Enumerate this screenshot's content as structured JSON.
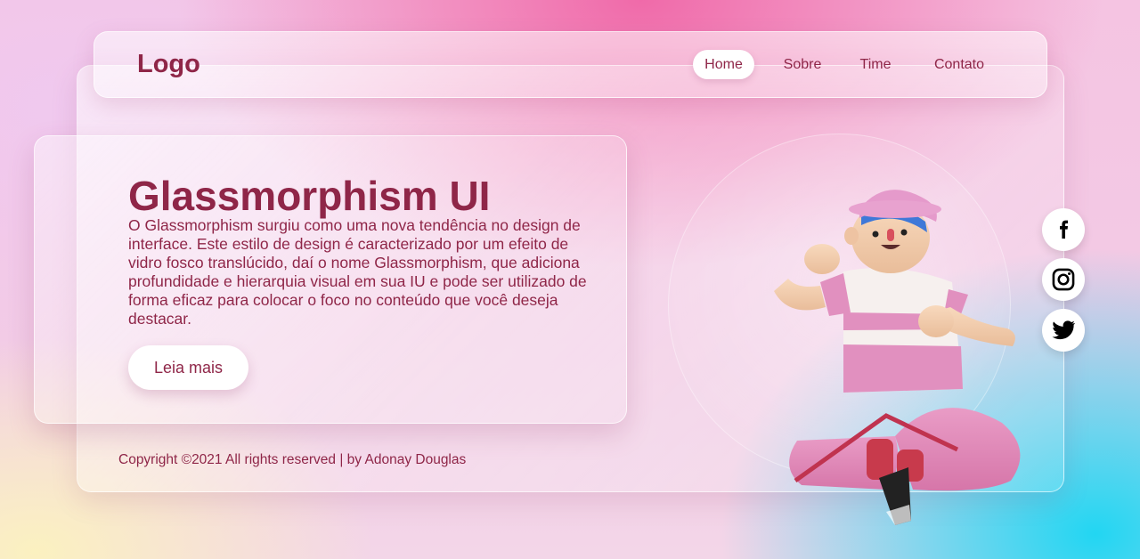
{
  "header": {
    "logo": "Logo",
    "nav": [
      {
        "label": "Home",
        "active": true
      },
      {
        "label": "Sobre",
        "active": false
      },
      {
        "label": "Time",
        "active": false
      },
      {
        "label": "Contato",
        "active": false
      }
    ]
  },
  "hero": {
    "title": "Glassmorphism UI",
    "description": "O Glassmorphism surgiu como uma nova tendência no design de interface. Este estilo de design é caracterizado por um efeito de vidro fosco translúcido, daí o nome Glassmorphism, que adiciona profundidade e hierarquia visual em sua IU e pode ser utilizado de forma eficaz para colocar o foco no conteúdo que você deseja destacar.",
    "button_label": "Leia mais"
  },
  "footer": {
    "copyright": "Copyright ©2021 All rights reserved | by Adonay Douglas"
  },
  "social": [
    {
      "icon": "facebook-icon"
    },
    {
      "icon": "instagram-icon"
    },
    {
      "icon": "twitter-icon"
    }
  ],
  "colors": {
    "accent": "#8f2648",
    "background_pink": "#f06aa9",
    "background_cyan": "#22d6f2",
    "background_cream": "#fbf1c0"
  }
}
